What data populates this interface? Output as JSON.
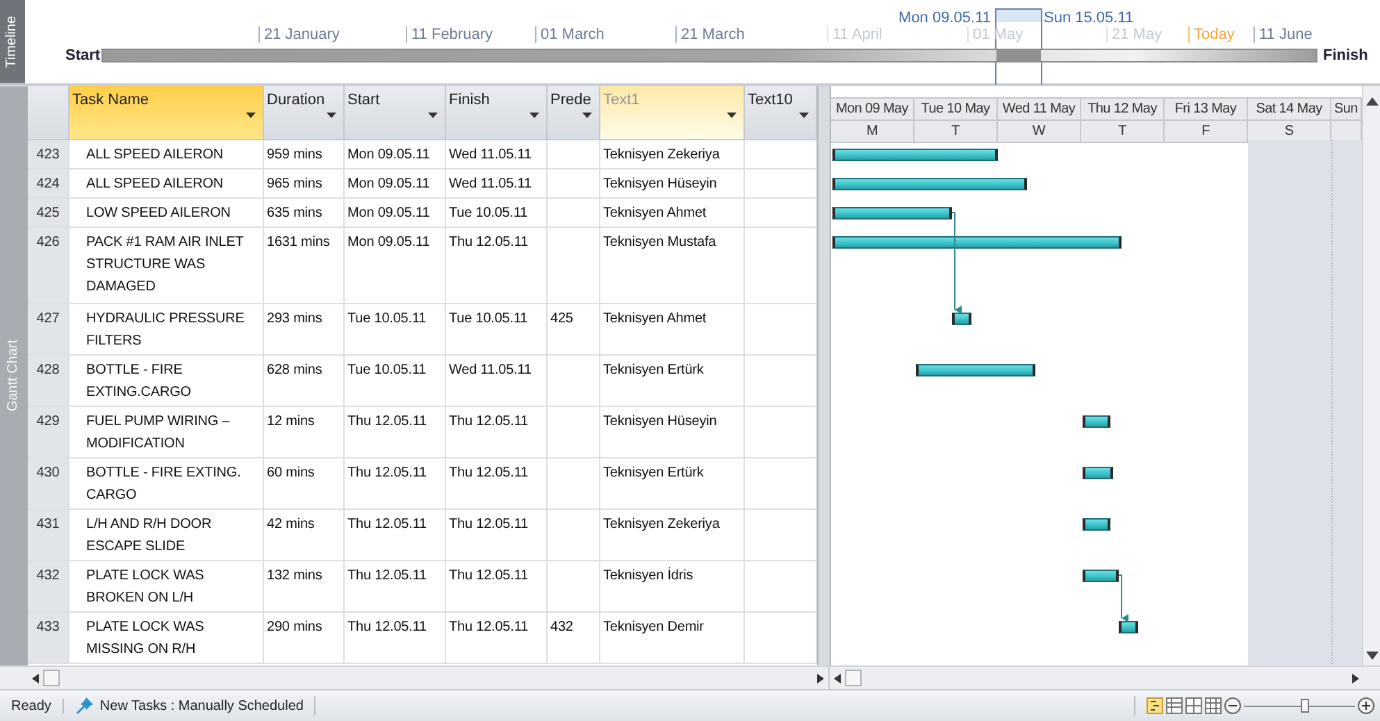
{
  "timeline": {
    "title": "Timeline",
    "start": "Start",
    "finish": "Finish",
    "window_start": "Mon 09.05.11",
    "window_end": "Sun 15.05.11",
    "ticks": [
      {
        "label": "21 January",
        "kind": "date",
        "dimmed": false
      },
      {
        "label": "11 February",
        "kind": "date",
        "dimmed": false
      },
      {
        "label": "01 March",
        "kind": "date",
        "dimmed": false
      },
      {
        "label": "21 March",
        "kind": "date",
        "dimmed": false
      },
      {
        "label": "11 April",
        "kind": "date",
        "dimmed": true
      },
      {
        "label": "01 May",
        "kind": "date",
        "dimmed": true
      },
      {
        "label": "21 May",
        "kind": "date",
        "dimmed": true
      },
      {
        "label": "Today",
        "kind": "today",
        "dimmed": false
      },
      {
        "label": "11 June",
        "kind": "date",
        "dimmed": false
      }
    ]
  },
  "view_tab": "Gantt Chart",
  "table": {
    "columns": [
      {
        "label": "Task Name",
        "selected": true,
        "hovered": false
      },
      {
        "label": "Duration",
        "selected": false,
        "hovered": false
      },
      {
        "label": "Start",
        "selected": false,
        "hovered": false
      },
      {
        "label": "Finish",
        "selected": false,
        "hovered": false
      },
      {
        "label": "Prede",
        "selected": false,
        "hovered": false
      },
      {
        "label": "Text1",
        "selected": false,
        "hovered": true
      },
      {
        "label": "Text10",
        "selected": false,
        "hovered": false
      }
    ],
    "rows": [
      {
        "id": "423",
        "cells": [
          "ALL SPEED AILERON",
          "959 mins",
          "Mon 09.05.11",
          "Wed 11.05.11",
          "",
          "Teknisyen Zekeriya",
          ""
        ]
      },
      {
        "id": "424",
        "cells": [
          "ALL SPEED AILERON",
          "965 mins",
          "Mon 09.05.11",
          "Wed 11.05.11",
          "",
          "Teknisyen Hüseyin",
          ""
        ]
      },
      {
        "id": "425",
        "cells": [
          "LOW SPEED AILERON",
          "635 mins",
          "Mon 09.05.11",
          "Tue 10.05.11",
          "",
          "Teknisyen Ahmet",
          ""
        ]
      },
      {
        "id": "426",
        "cells": [
          "PACK #1 RAM AIR INLET STRUCTURE WAS DAMAGED",
          "1631 mins",
          "Mon 09.05.11",
          "Thu 12.05.11",
          "",
          "Teknisyen Mustafa",
          ""
        ]
      },
      {
        "id": "427",
        "cells": [
          "HYDRAULIC PRESSURE FILTERS",
          "293 mins",
          "Tue 10.05.11",
          "Tue 10.05.11",
          "425",
          "Teknisyen Ahmet",
          ""
        ]
      },
      {
        "id": "428",
        "cells": [
          "BOTTLE - FIRE EXTING.CARGO",
          "628 mins",
          "Tue 10.05.11",
          "Wed 11.05.11",
          "",
          "Teknisyen Ertürk",
          ""
        ]
      },
      {
        "id": "429",
        "cells": [
          "FUEL PUMP WIRING – MODIFICATION",
          "12 mins",
          "Thu 12.05.11",
          "Thu 12.05.11",
          "",
          "Teknisyen Hüseyin",
          ""
        ]
      },
      {
        "id": "430",
        "cells": [
          "BOTTLE - FIRE EXTING. CARGO",
          "60 mins",
          "Thu 12.05.11",
          "Thu 12.05.11",
          "",
          "Teknisyen Ertürk",
          ""
        ]
      },
      {
        "id": "431",
        "cells": [
          "L/H AND R/H DOOR ESCAPE SLIDE",
          "42 mins",
          "Thu 12.05.11",
          "Thu 12.05.11",
          "",
          "Teknisyen Zekeriya",
          ""
        ]
      },
      {
        "id": "432",
        "cells": [
          "PLATE LOCK WAS BROKEN ON L/H",
          "132 mins",
          "Thu 12.05.11",
          "Thu 12.05.11",
          "",
          "Teknisyen İdris",
          ""
        ]
      },
      {
        "id": "433",
        "cells": [
          "PLATE LOCK WAS MISSING ON R/H",
          "290 mins",
          "Thu 12.05.11",
          "Thu 12.05.11",
          "432",
          "Teknisyen Demir",
          ""
        ]
      }
    ]
  },
  "gantt": {
    "days": [
      {
        "label": "Mon 09 May",
        "letter": "M",
        "nonworking": false
      },
      {
        "label": "Tue 10 May",
        "letter": "T",
        "nonworking": false
      },
      {
        "label": "Wed 11 May",
        "letter": "W",
        "nonworking": false
      },
      {
        "label": "Thu 12 May",
        "letter": "T",
        "nonworking": false
      },
      {
        "label": "Fri 13 May",
        "letter": "F",
        "nonworking": false
      },
      {
        "label": "Sat 14 May",
        "letter": "S",
        "nonworking": true
      },
      {
        "label": "Sun",
        "nonworking": true
      }
    ]
  },
  "status_bar": {
    "ready": "Ready",
    "new_tasks": "New Tasks : Manually Scheduled",
    "zoom": {
      "level": 0.55
    }
  }
}
